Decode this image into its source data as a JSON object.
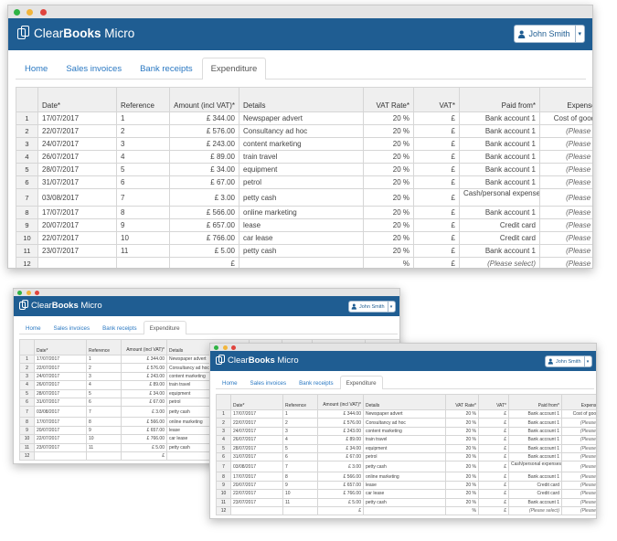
{
  "colors": {
    "app_bar": "#1f5d92",
    "tab_link": "#2a78c2",
    "title_bar": "#e4e4e4"
  },
  "window_controls": [
    "close",
    "minimize",
    "zoom"
  ],
  "app": {
    "logo_part1": "Clear",
    "logo_part2": "Books",
    "logo_part3": " Micro",
    "icon": "documents-logo-icon"
  },
  "user": {
    "name": "John Smith",
    "icon": "person-icon",
    "caret": "▾"
  },
  "tabs": [
    {
      "label": "Home",
      "active": false
    },
    {
      "label": "Sales invoices",
      "active": false
    },
    {
      "label": "Bank receipts",
      "active": false
    },
    {
      "label": "Expenditure",
      "active": true
    }
  ],
  "table": {
    "columns": {
      "date": "Date*",
      "reference": "Reference",
      "amount": "Amount (incl VAT)*",
      "details": "Details",
      "vat_rate": "VAT Rate*",
      "vat": "VAT*",
      "paid_from": "Paid from*",
      "expense_type": "Expense type*"
    },
    "rows": [
      {
        "num": "1",
        "date": "17/07/2017",
        "reference": "1",
        "amount": "£ 344.00",
        "details": "Newspaper advert",
        "vat_rate": "20 %",
        "vat": "£",
        "paid_from": "Bank account 1",
        "expense_type": "Cost of goods sold"
      },
      {
        "num": "2",
        "date": "22/07/2017",
        "reference": "2",
        "amount": "£ 576.00",
        "details": "Consultancy ad hoc",
        "vat_rate": "20 %",
        "vat": "£",
        "paid_from": "Bank account 1",
        "expense_type": "(Please select)"
      },
      {
        "num": "3",
        "date": "24/07/2017",
        "reference": "3",
        "amount": "£ 243.00",
        "details": "content marketing",
        "vat_rate": "20 %",
        "vat": "£",
        "paid_from": "Bank account 1",
        "expense_type": "(Please select)"
      },
      {
        "num": "4",
        "date": "26/07/2017",
        "reference": "4",
        "amount": "£ 89.00",
        "details": "train travel",
        "vat_rate": "20 %",
        "vat": "£",
        "paid_from": "Bank account 1",
        "expense_type": "(Please select)"
      },
      {
        "num": "5",
        "date": "28/07/2017",
        "reference": "5",
        "amount": "£ 34.00",
        "details": "equipment",
        "vat_rate": "20 %",
        "vat": "£",
        "paid_from": "Bank account 1",
        "expense_type": "(Please select)"
      },
      {
        "num": "6",
        "date": "31/07/2017",
        "reference": "6",
        "amount": "£ 67.00",
        "details": "petrol",
        "vat_rate": "20 %",
        "vat": "£",
        "paid_from": "Bank account 1",
        "expense_type": "(Please select)"
      },
      {
        "num": "7",
        "date": "03/08/2017",
        "reference": "7",
        "amount": "£ 3.00",
        "details": "petty cash",
        "vat_rate": "20 %",
        "vat": "£",
        "paid_from": "Cash/personal expenses",
        "expense_type": "(Please select)"
      },
      {
        "num": "8",
        "date": "17/07/2017",
        "reference": "8",
        "amount": "£ 566.00",
        "details": "online marketing",
        "vat_rate": "20 %",
        "vat": "£",
        "paid_from": "Bank account 1",
        "expense_type": "(Please select)"
      },
      {
        "num": "9",
        "date": "20/07/2017",
        "reference": "9",
        "amount": "£ 657.00",
        "details": "lease",
        "vat_rate": "20 %",
        "vat": "£",
        "paid_from": "Credit card",
        "expense_type": "(Please select)"
      },
      {
        "num": "10",
        "date": "22/07/2017",
        "reference": "10",
        "amount": "£ 766.00",
        "details": "car lease",
        "vat_rate": "20 %",
        "vat": "£",
        "paid_from": "Credit card",
        "expense_type": "(Please select)"
      },
      {
        "num": "11",
        "date": "23/07/2017",
        "reference": "11",
        "amount": "£ 5.00",
        "details": "petty cash",
        "vat_rate": "20 %",
        "vat": "£",
        "paid_from": "Bank account 1",
        "expense_type": "(Please select)"
      },
      {
        "num": "12",
        "date": "",
        "reference": "",
        "amount": "£",
        "details": "",
        "vat_rate": "%",
        "vat": "£",
        "paid_from": "(Please select)",
        "expense_type": "(Please select)"
      }
    ]
  },
  "windows": [
    {
      "id": "main",
      "visible_columns": [
        "date",
        "reference",
        "amount",
        "details",
        "vat_rate",
        "vat",
        "paid_from",
        "expense_type"
      ]
    },
    {
      "id": "middle",
      "visible_columns": [
        "date",
        "reference",
        "amount",
        "details",
        "vat_rate",
        "vat",
        "paid_from",
        "expense_type"
      ]
    },
    {
      "id": "front",
      "visible_columns": [
        "date",
        "reference",
        "amount",
        "details",
        "vat_rate",
        "vat",
        "paid_from",
        "expense_type"
      ]
    }
  ]
}
